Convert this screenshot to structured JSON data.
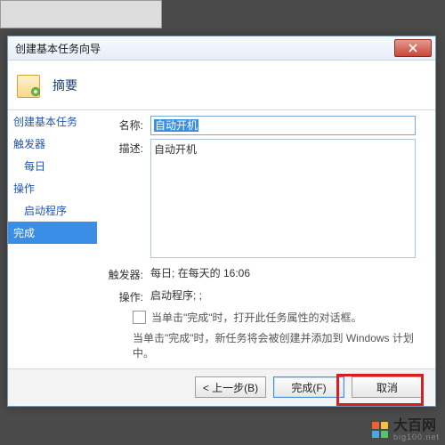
{
  "window": {
    "title": "创建基本任务向导"
  },
  "header": {
    "title": "摘要"
  },
  "sidebar": {
    "items": [
      {
        "label": "创建基本任务"
      },
      {
        "label": "触发器"
      },
      {
        "label": "每日"
      },
      {
        "label": "操作"
      },
      {
        "label": "启动程序"
      },
      {
        "label": "完成"
      }
    ]
  },
  "form": {
    "name_label": "名称:",
    "name_value": "自动开机",
    "desc_label": "描述:",
    "desc_value": "自动开机",
    "trigger_label": "触发器:",
    "trigger_value": "每日; 在每天的 16:06",
    "action_label": "操作:",
    "action_value": "启动程序; ;",
    "checkbox_label": "当单击\"完成\"时，打开此任务属性的对话框。",
    "hint": "当单击\"完成\"时，新任务将会被创建并添加到 Windows 计划中。"
  },
  "buttons": {
    "back": "< 上一步(B)",
    "finish": "完成(F)",
    "cancel": "取消"
  },
  "watermark": {
    "main": "大百网",
    "sub": "big100.net"
  },
  "colors": {
    "accent": "#3a8ee6",
    "highlight": "#d52020"
  }
}
